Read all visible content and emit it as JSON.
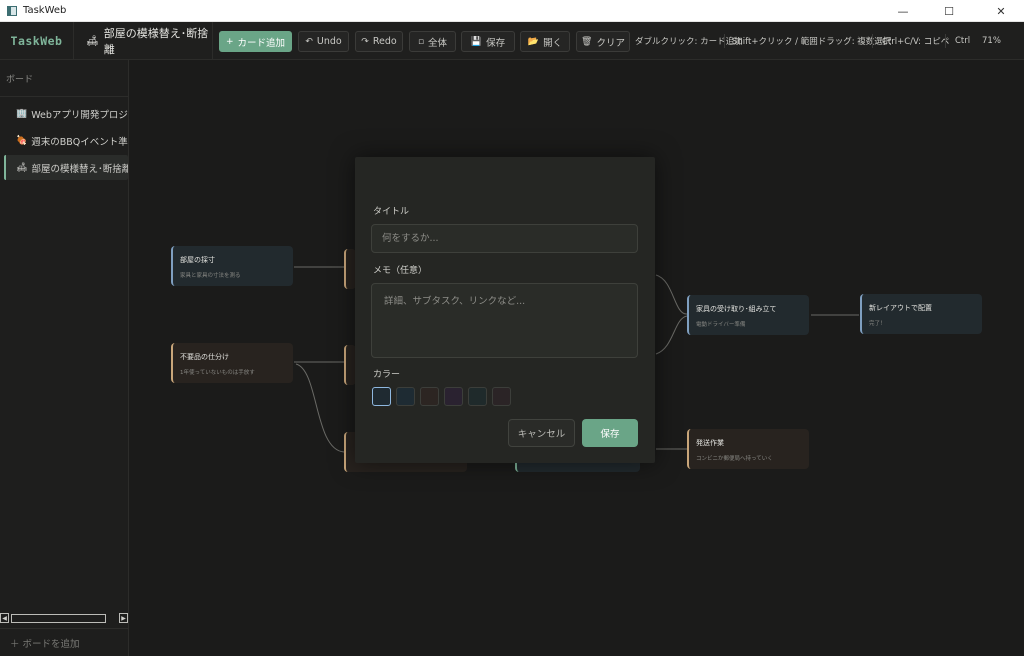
{
  "window": {
    "title": "TaskWeb",
    "minimize": "—",
    "maximize": "☐",
    "close": "✕"
  },
  "toolbar": {
    "brand": "TaskWeb",
    "board_icon": "🛋",
    "board_name": "部屋の模様替え･断捨離",
    "buttons": {
      "add_card": {
        "icon": "+",
        "label": "カード追加"
      },
      "undo": {
        "icon": "↶",
        "label": "Undo"
      },
      "redo": {
        "icon": "↷",
        "label": "Redo"
      },
      "fit_all": {
        "icon": "▫",
        "label": "全体"
      },
      "save": {
        "icon": "💾",
        "label": "保存"
      },
      "open": {
        "icon": "📂",
        "label": "開く"
      },
      "clear": {
        "icon": "🗑",
        "label": "クリア"
      }
    },
    "hints": {
      "dblclick": "ダブルクリック: カード追加",
      "shift": "Shift+クリック / 範囲ドラッグ: 複数選択",
      "copy": "Ctrl+C/V: コピペ",
      "ctrl": "Ctrl",
      "zoom": "71%"
    }
  },
  "sidebar": {
    "header": "ボード",
    "boards": [
      {
        "icon": "🏢",
        "label": "Webアプリ開発プロジェクト",
        "active": false
      },
      {
        "icon": "🍖",
        "label": "週末のBBQイベント準備",
        "active": false
      },
      {
        "icon": "🛋",
        "label": "部屋の模様替え･断捨離",
        "active": true
      }
    ],
    "add_board": "＋ ボードを追加",
    "scroll_left": "◀",
    "scroll_right": "▶"
  },
  "cards": [
    {
      "id": "c1",
      "title": "部屋の採寸",
      "sub": "家具と家具の寸法を測る",
      "tone": "blue"
    },
    {
      "id": "c2",
      "title": "不要品の仕分け",
      "sub": "1年使っていないものは手放す",
      "tone": "brown"
    },
    {
      "id": "c3",
      "title": "家具の受け取り･組み立て",
      "sub": "電動ドライバー準備",
      "tone": "blue"
    },
    {
      "id": "c4",
      "title": "新レイアウトで配置",
      "sub": "完了！",
      "tone": "blue"
    },
    {
      "id": "c5",
      "title": "発送作業",
      "sub": "コンビニか郵便局へ持っていく",
      "tone": "brown"
    }
  ],
  "modal": {
    "title_label": "タイトル",
    "title_placeholder": "何をするか...",
    "memo_label": "メモ（任意）",
    "memo_placeholder": "詳細、サブタスク、リンクなど...",
    "color_label": "カラー",
    "colors": [
      "#1f2a31",
      "#1e2b33",
      "#2c2522",
      "#2a2230",
      "#1f2a2b",
      "#2b2426"
    ],
    "selected_color": 0,
    "cancel": "キャンセル",
    "save": "保存"
  }
}
